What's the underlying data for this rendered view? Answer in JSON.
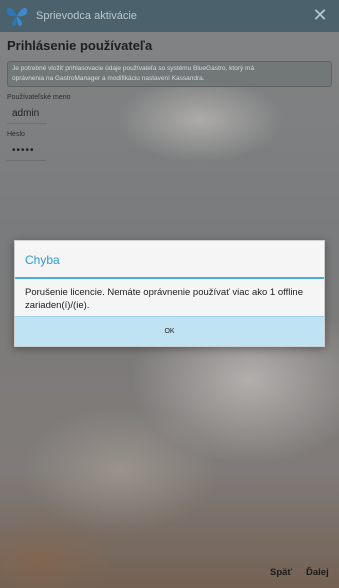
{
  "window": {
    "title": "Sprievodca aktivácie",
    "close_icon": "close-icon"
  },
  "login": {
    "heading": "Prihlásenie používateľa",
    "info_line1": "Je potrebné vložiť prihlasovacie údaje používateľa so systému BlueGastro, ktorý má",
    "info_line2": "oprávnenia na GastroManager a modifikáciu nastavení Kassandra.",
    "username_label": "Používateľské meno",
    "username_value": "admin",
    "password_label": "Heslo",
    "password_value": "•••••"
  },
  "dialog": {
    "title": "Chyba",
    "message": "Porušenie licencie. Nemáte oprávnenie používať viac ako 1 offline zariaden(í)/(ie).",
    "ok_label": "OK"
  },
  "footer": {
    "back_label": "Späť",
    "next_label": "Ďalej"
  },
  "colors": {
    "accent": "#2e9bd3",
    "titlebar": "#46606a",
    "ok_button": "#bfe3f3"
  }
}
